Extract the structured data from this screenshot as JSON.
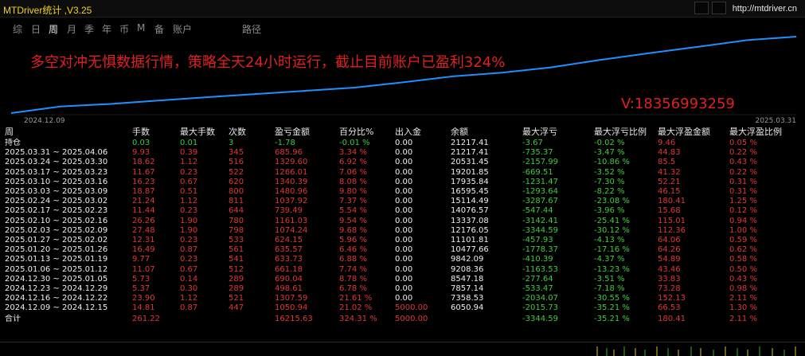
{
  "window": {
    "title": "MTDriver统计 ,V3.25",
    "url": "http://mtdriver.cn"
  },
  "tabs": [
    {
      "label": "综",
      "active": false
    },
    {
      "label": "日",
      "active": false
    },
    {
      "label": "周",
      "active": true
    },
    {
      "label": "月",
      "active": false
    },
    {
      "label": "季",
      "active": false
    },
    {
      "label": "年",
      "active": false
    },
    {
      "label": "币",
      "active": false
    },
    {
      "label": "M",
      "active": false
    },
    {
      "label": "备",
      "active": false
    },
    {
      "label": "账户",
      "active": false
    },
    {
      "label": "路径",
      "active": false
    }
  ],
  "overlay": {
    "banner": "多空对冲无惧数据行情，策略全天24小时运行，截止目前账户已盈利324%",
    "contact": "V:18356993259"
  },
  "chart_data": {
    "type": "line",
    "x_start_label": "2024.12.09",
    "x_end_label": "2025.03.31",
    "line_color": "#1e90ff",
    "series": [
      {
        "values": [
          6050.94,
          7358.53,
          7857.14,
          8547.18,
          9208.36,
          9842.09,
          10477.66,
          11101.81,
          12176.05,
          13337.08,
          14076.57,
          15114.49,
          16595.45,
          17935.84,
          19201.85,
          20531.45,
          21217.41
        ]
      }
    ]
  },
  "table": {
    "headers": [
      "周",
      "手数",
      "最大手数",
      "次数",
      "盈亏金额",
      "百分比%",
      "出入金",
      "余额",
      "最大浮亏",
      "最大浮亏比例",
      "最大浮盈金额",
      "最大浮盈比例"
    ],
    "position_row": {
      "label": "持仓",
      "lots": "0.03",
      "max_lots": "0.01",
      "count": "3",
      "pnl": "-1.78",
      "pct": "-0.01 %",
      "flow": "0.00",
      "balance": "21217.41",
      "max_loss": "-3.67",
      "max_loss_pct": "-0.02 %",
      "max_profit": "9.46",
      "max_profit_pct": "0.05 %"
    },
    "rows": [
      {
        "period": "2025.03.31 ~ 2025.04.06",
        "lots": "9.93",
        "max_lots": "0.39",
        "count": "345",
        "pnl": "685.96",
        "pct": "3.34 %",
        "flow": "0.00",
        "balance": "21217.41",
        "max_loss": "-735.37",
        "max_loss_pct": "-3.47 %",
        "max_profit": "44.83",
        "max_profit_pct": "0.22 %"
      },
      {
        "period": "2025.03.24 ~ 2025.03.30",
        "lots": "18.62",
        "max_lots": "1.12",
        "count": "516",
        "pnl": "1329.60",
        "pct": "6.92 %",
        "flow": "0.00",
        "balance": "20531.45",
        "max_loss": "-2157.99",
        "max_loss_pct": "-10.86 %",
        "max_profit": "85.5",
        "max_profit_pct": "0.43 %"
      },
      {
        "period": "2025.03.17 ~ 2025.03.23",
        "lots": "11.67",
        "max_lots": "0.23",
        "count": "522",
        "pnl": "1266.01",
        "pct": "7.06 %",
        "flow": "0.00",
        "balance": "19201.85",
        "max_loss": "-669.51",
        "max_loss_pct": "-3.52 %",
        "max_profit": "41.32",
        "max_profit_pct": "0.22 %"
      },
      {
        "period": "2025.03.10 ~ 2025.03.16",
        "lots": "16.23",
        "max_lots": "0.67",
        "count": "620",
        "pnl": "1340.39",
        "pct": "8.08 %",
        "flow": "0.00",
        "balance": "17935.84",
        "max_loss": "-1231.47",
        "max_loss_pct": "-7.30 %",
        "max_profit": "52.21",
        "max_profit_pct": "0.31 %"
      },
      {
        "period": "2025.03.03 ~ 2025.03.09",
        "lots": "18.87",
        "max_lots": "0.51",
        "count": "800",
        "pnl": "1480.96",
        "pct": "9.80 %",
        "flow": "0.00",
        "balance": "16595.45",
        "max_loss": "-1293.64",
        "max_loss_pct": "-8.22 %",
        "max_profit": "46.15",
        "max_profit_pct": "0.31 %"
      },
      {
        "period": "2025.02.24 ~ 2025.03.02",
        "lots": "21.24",
        "max_lots": "1.12",
        "count": "811",
        "pnl": "1037.92",
        "pct": "7.37 %",
        "flow": "0.00",
        "balance": "15114.49",
        "max_loss": "-3287.67",
        "max_loss_pct": "-23.08 %",
        "max_profit": "180.41",
        "max_profit_pct": "1.25 %"
      },
      {
        "period": "2025.02.17 ~ 2025.02.23",
        "lots": "11.44",
        "max_lots": "0.23",
        "count": "644",
        "pnl": "739.49",
        "pct": "5.54 %",
        "flow": "0.00",
        "balance": "14076.57",
        "max_loss": "-547.44",
        "max_loss_pct": "-3.96 %",
        "max_profit": "15.68",
        "max_profit_pct": "0.12 %"
      },
      {
        "period": "2025.02.10 ~ 2025.02.16",
        "lots": "26.26",
        "max_lots": "1.90",
        "count": "780",
        "pnl": "1161.03",
        "pct": "9.54 %",
        "flow": "0.00",
        "balance": "13337.08",
        "max_loss": "-3142.41",
        "max_loss_pct": "-25.41 %",
        "max_profit": "115.01",
        "max_profit_pct": "0.94 %"
      },
      {
        "period": "2025.02.03 ~ 2025.02.09",
        "lots": "27.48",
        "max_lots": "1.90",
        "count": "798",
        "pnl": "1074.24",
        "pct": "9.68 %",
        "flow": "0.00",
        "balance": "12176.05",
        "max_loss": "-3344.59",
        "max_loss_pct": "-30.12 %",
        "max_profit": "112.36",
        "max_profit_pct": "1.00 %"
      },
      {
        "period": "2025.01.27 ~ 2025.02.02",
        "lots": "12.31",
        "max_lots": "0.23",
        "count": "533",
        "pnl": "624.15",
        "pct": "5.96 %",
        "flow": "0.00",
        "balance": "11101.81",
        "max_loss": "-457.93",
        "max_loss_pct": "-4.13 %",
        "max_profit": "64.06",
        "max_profit_pct": "0.59 %"
      },
      {
        "period": "2025.01.20 ~ 2025.01.26",
        "lots": "16.49",
        "max_lots": "0.87",
        "count": "561",
        "pnl": "635.57",
        "pct": "6.46 %",
        "flow": "0.00",
        "balance": "10477.66",
        "max_loss": "-1778.37",
        "max_loss_pct": "-17.16 %",
        "max_profit": "64.26",
        "max_profit_pct": "0.62 %"
      },
      {
        "period": "2025.01.13 ~ 2025.01.19",
        "lots": "9.77",
        "max_lots": "0.23",
        "count": "541",
        "pnl": "633.73",
        "pct": "6.88 %",
        "flow": "0.00",
        "balance": "9842.09",
        "max_loss": "-410.39",
        "max_loss_pct": "-4.37 %",
        "max_profit": "54.89",
        "max_profit_pct": "0.58 %"
      },
      {
        "period": "2025.01.06 ~ 2025.01.12",
        "lots": "11.07",
        "max_lots": "0.67",
        "count": "512",
        "pnl": "661.18",
        "pct": "7.74 %",
        "flow": "0.00",
        "balance": "9208.36",
        "max_loss": "-1163.53",
        "max_loss_pct": "-13.23 %",
        "max_profit": "43.46",
        "max_profit_pct": "0.50 %"
      },
      {
        "period": "2024.12.30 ~ 2025.01.05",
        "lots": "5.73",
        "max_lots": "0.14",
        "count": "289",
        "pnl": "690.04",
        "pct": "8.78 %",
        "flow": "0.00",
        "balance": "8547.18",
        "max_loss": "-277.64",
        "max_loss_pct": "-3.51 %",
        "max_profit": "33.83",
        "max_profit_pct": "0.43 %"
      },
      {
        "period": "2024.12.23 ~ 2024.12.29",
        "lots": "5.37",
        "max_lots": "0.30",
        "count": "289",
        "pnl": "498.61",
        "pct": "6.78 %",
        "flow": "0.00",
        "balance": "7857.14",
        "max_loss": "-533.47",
        "max_loss_pct": "-7.18 %",
        "max_profit": "73.28",
        "max_profit_pct": "0.98 %"
      },
      {
        "period": "2024.12.16 ~ 2024.12.22",
        "lots": "23.90",
        "max_lots": "1.12",
        "count": "521",
        "pnl": "1307.59",
        "pct": "21.61 %",
        "flow": "0.00",
        "balance": "7358.53",
        "max_loss": "-2034.07",
        "max_loss_pct": "-30.55 %",
        "max_profit": "152.13",
        "max_profit_pct": "2.11 %"
      },
      {
        "period": "2024.12.09 ~ 2024.12.15",
        "lots": "14.81",
        "max_lots": "0.87",
        "count": "447",
        "pnl": "1050.94",
        "pct": "21.02 %",
        "flow": "5000.00",
        "balance": "6050.94",
        "max_loss": "-2015.73",
        "max_loss_pct": "-35.21 %",
        "max_profit": "66.53",
        "max_profit_pct": "1.30 %"
      }
    ],
    "total_row": {
      "label": "合计",
      "lots": "261.22",
      "pnl": "16215.63",
      "pct": "324.31 %",
      "flow": "5000.00",
      "max_loss": "-3344.59",
      "max_loss_pct": "-35.21 %",
      "max_profit": "180.41",
      "max_profit_pct": "2.11 %"
    }
  },
  "colors": {
    "background": "#000000",
    "title": "#f2d31d",
    "positive": "#e23636",
    "negative": "#3ecb3e",
    "neutral": "#f0f0f0",
    "line": "#1e90ff"
  }
}
